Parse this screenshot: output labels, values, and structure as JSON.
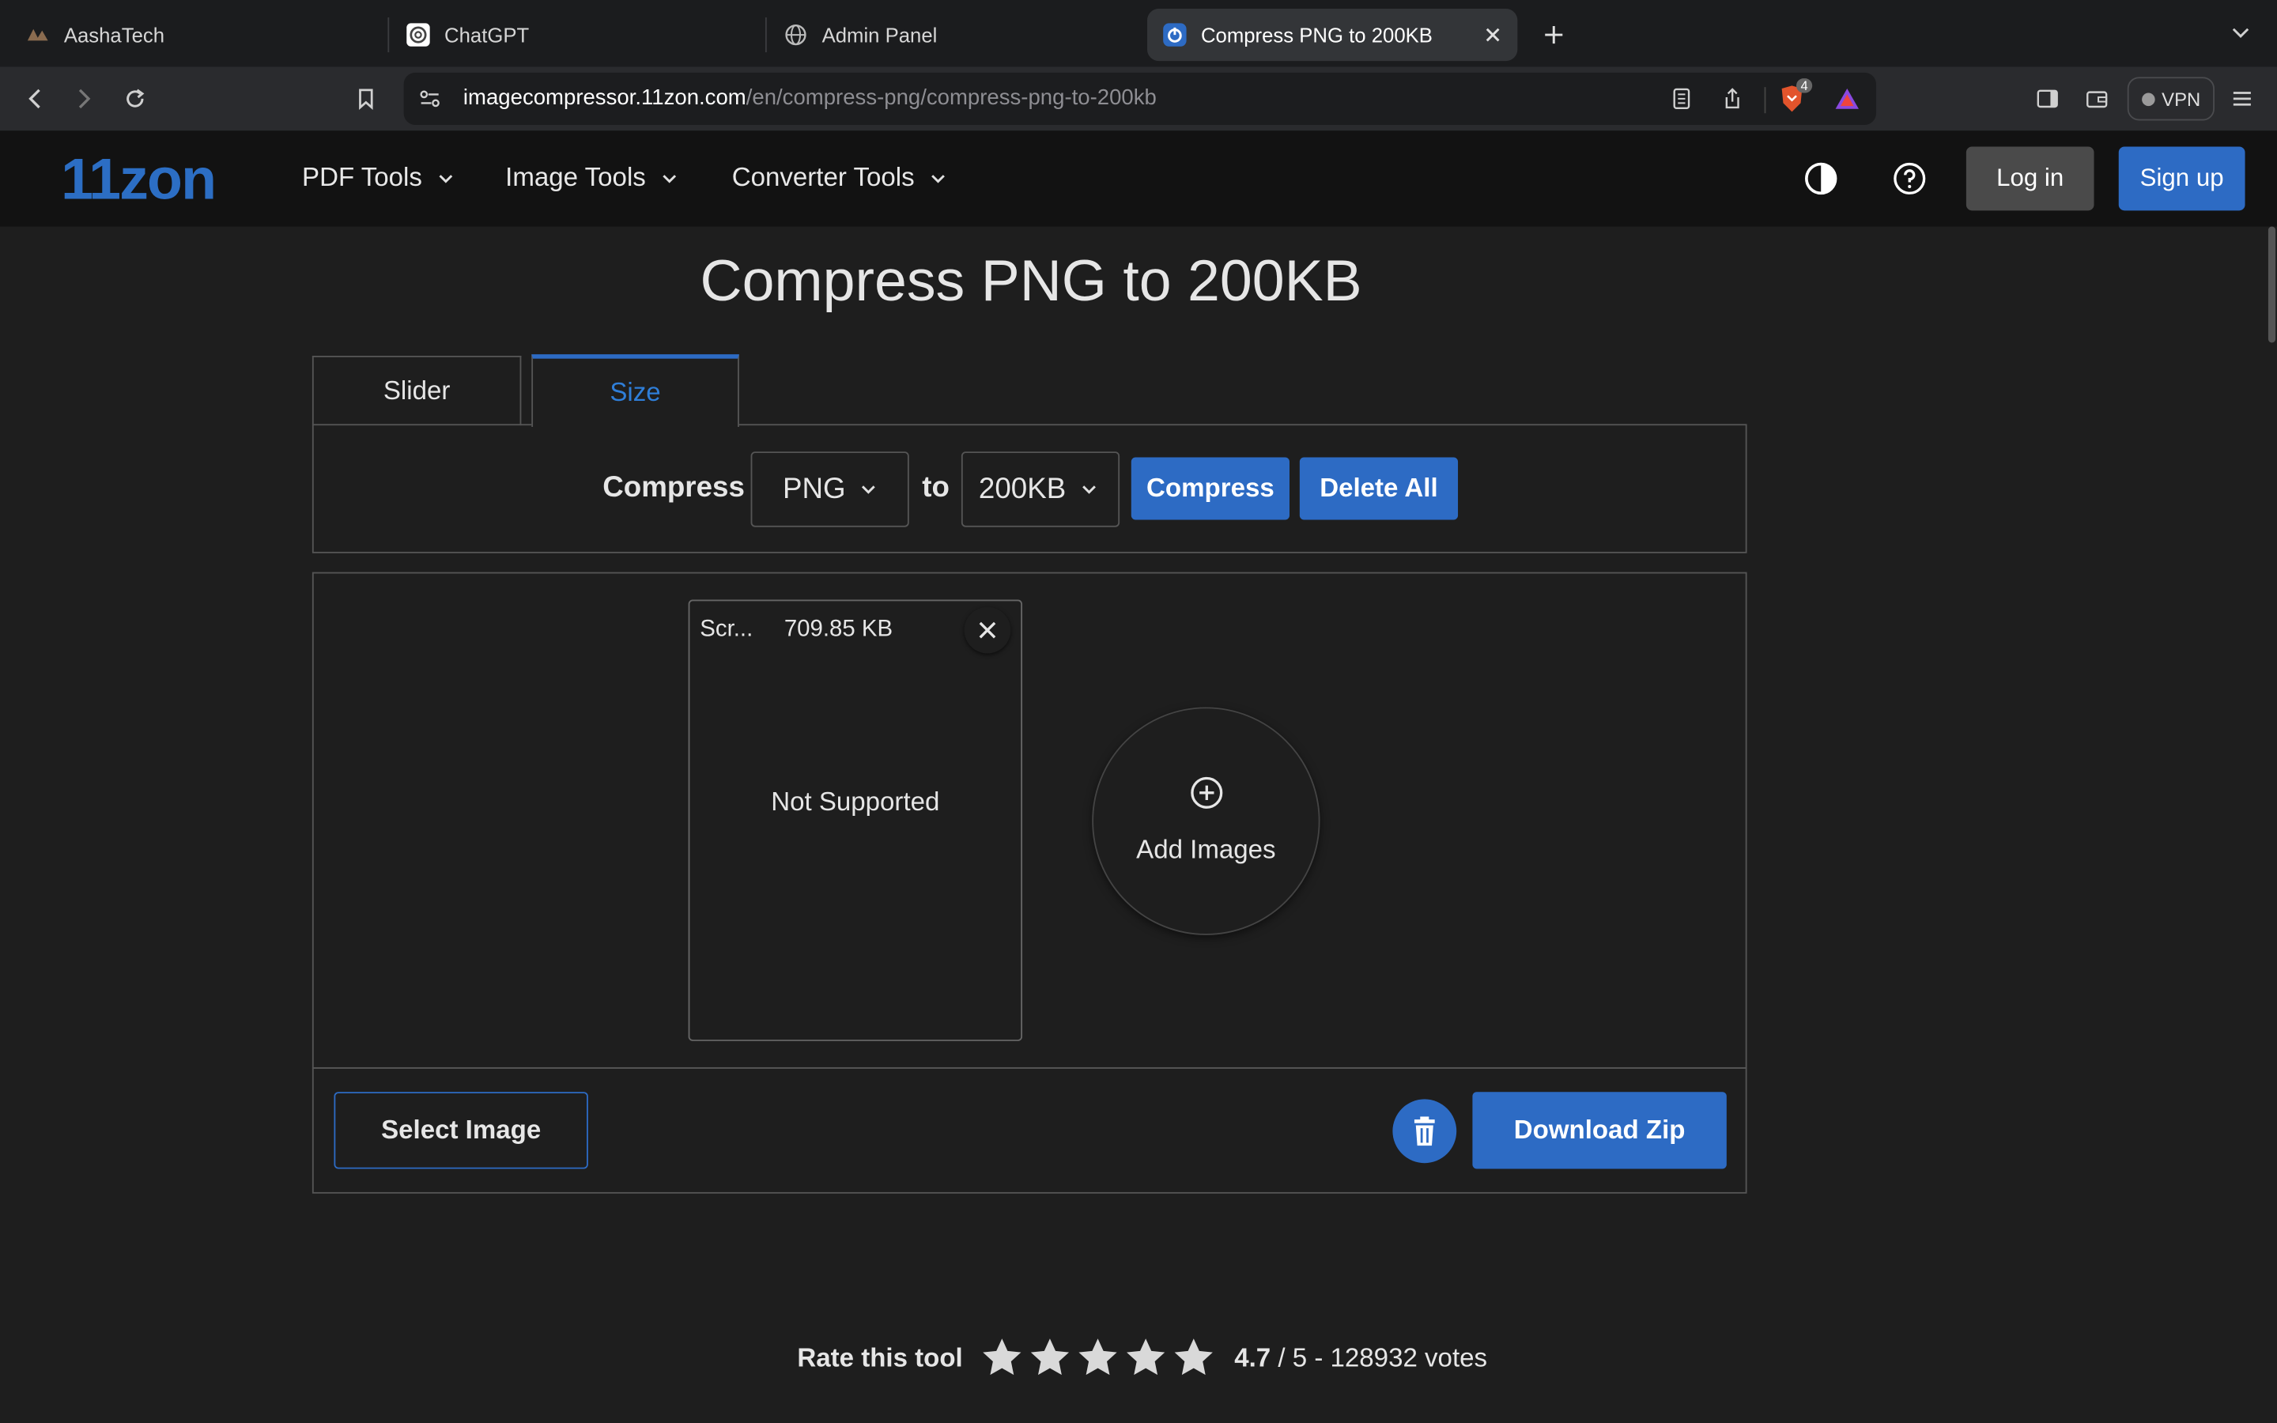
{
  "browser": {
    "tabs": [
      {
        "title": "AashaTech"
      },
      {
        "title": "ChatGPT"
      },
      {
        "title": "Admin Panel"
      },
      {
        "title": "Compress PNG to 200KB"
      }
    ],
    "url_host": "imagecompressor.11zon.com",
    "url_path": "/en/compress-png/compress-png-to-200kb",
    "shield_count": "4",
    "vpn_label": "VPN"
  },
  "site": {
    "logo": "11zon",
    "nav": [
      "PDF Tools",
      "Image Tools",
      "Converter Tools"
    ],
    "login_label": "Log in",
    "signup_label": "Sign up"
  },
  "main": {
    "title": "Compress PNG to 200KB",
    "tabs": [
      "Slider",
      "Size"
    ],
    "active_tab": "Size",
    "compress_label": "Compress",
    "format_value": "PNG",
    "to_label": "to",
    "size_value": "200KB",
    "compress_button": "Compress",
    "delete_all_button": "Delete All",
    "file": {
      "name": "Scr...",
      "size": "709.85 KB",
      "status": "Not Supported"
    },
    "add_images_label": "Add Images",
    "select_image_button": "Select Image",
    "download_button": "Download Zip"
  },
  "rating": {
    "label": "Rate this tool",
    "stars": 5,
    "value": "4.7",
    "rest": "/ 5 - 128932 votes"
  },
  "colors": {
    "accent": "#2d6bc4",
    "page_bg": "#1e1e1e",
    "nav_bg": "#121212"
  }
}
